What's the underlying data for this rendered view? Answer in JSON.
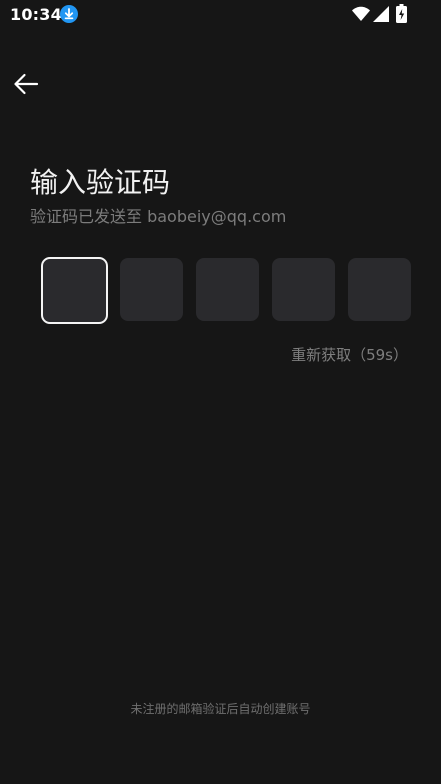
{
  "status_bar": {
    "time": "10:34"
  },
  "icons": {
    "download": "download-icon",
    "wifi": "wifi-icon",
    "signal": "signal-icon",
    "battery": "battery-charging-icon",
    "back": "arrow-left-icon"
  },
  "colors": {
    "background": "#161616",
    "code_box": "#2a2a2d",
    "active_border": "#f4f4f4",
    "download_badge": "#2196f3"
  },
  "page": {
    "title": "输入验证码",
    "subtitle": "验证码已发送至 baobeiy@qq.com",
    "resend": "重新获取（59s）",
    "footer_note": "未注册的邮箱验证后自动创建账号"
  },
  "code_inputs": {
    "count": 5,
    "active_index": 0,
    "values": [
      "",
      "",
      "",
      "",
      ""
    ]
  }
}
